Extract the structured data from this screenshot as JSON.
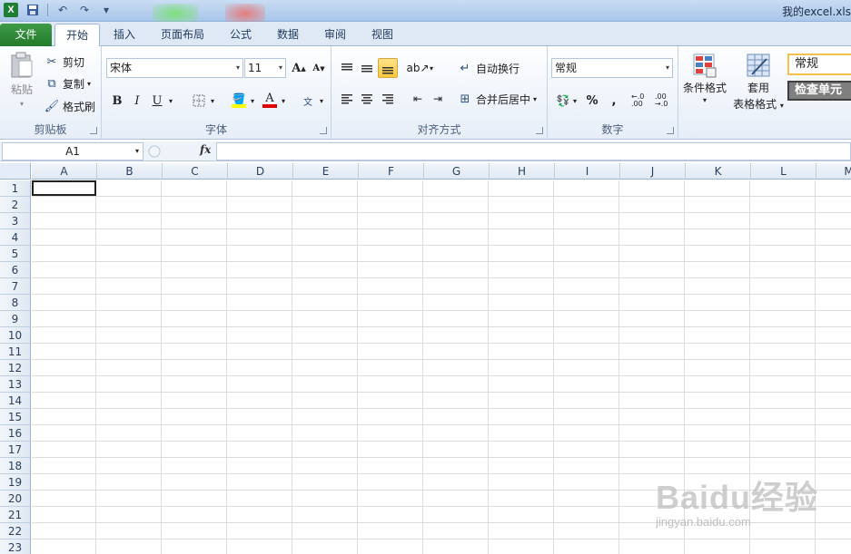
{
  "window": {
    "title": "我的excel.xls"
  },
  "tabs": [
    {
      "label": "文件"
    },
    {
      "label": "开始"
    },
    {
      "label": "插入"
    },
    {
      "label": "页面布局"
    },
    {
      "label": "公式"
    },
    {
      "label": "数据"
    },
    {
      "label": "审阅"
    },
    {
      "label": "视图"
    }
  ],
  "ribbon": {
    "clipboard": {
      "label": "剪贴板",
      "paste": "粘贴",
      "cut": "剪切",
      "copy": "复制",
      "format_painter": "格式刷"
    },
    "font": {
      "label": "字体",
      "font_name": "宋体",
      "font_size": "11",
      "bold": "B",
      "italic": "I",
      "underline": "U",
      "font_color": "A",
      "grow": "A",
      "shrink": "A"
    },
    "alignment": {
      "label": "对齐方式",
      "wrap_text": "自动换行",
      "merge_center": "合并后居中"
    },
    "number": {
      "label": "数字",
      "format": "常规",
      "percent": "%",
      "comma": ",",
      "increase_decimal": "←.0 .00",
      "decrease_decimal": ".00 →.0"
    },
    "styles": {
      "conditional": "条件格式",
      "table_format_1": "套用",
      "table_format_2": "表格格式",
      "style_normal": "常规",
      "style_check": "检查单元"
    }
  },
  "formula_bar": {
    "name_box": "A1",
    "fx": "fx",
    "value": ""
  },
  "sheet": {
    "columns": [
      "A",
      "B",
      "C",
      "D",
      "E",
      "F",
      "G",
      "H",
      "I",
      "J",
      "K",
      "L",
      "M"
    ],
    "rows": [
      "1",
      "2",
      "3",
      "4",
      "5",
      "6",
      "7",
      "8",
      "9",
      "10",
      "11",
      "12",
      "13",
      "14",
      "15",
      "16",
      "17",
      "18",
      "19",
      "20",
      "21",
      "22",
      "23"
    ],
    "selected_cell": "A1"
  },
  "watermark": {
    "logo": "Baidu经验",
    "url": "jingyan.baidu.com"
  },
  "colors": {
    "file_tab": "#237b2c",
    "ribbon_bg": "#e7eef8",
    "selected_style_bg": "#ffe38a",
    "check_cell_bg": "#7f7f7f"
  }
}
